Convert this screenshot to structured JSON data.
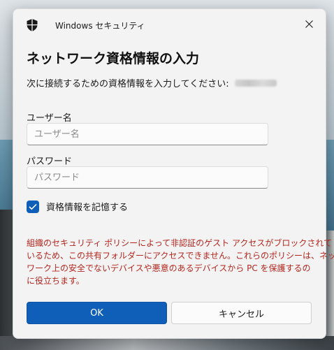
{
  "window": {
    "app_title": "Windows セキュリティ",
    "close_icon": "close-icon",
    "app_icon": "shield-icon"
  },
  "dialog": {
    "heading": "ネットワーク資格情報の入力",
    "prompt": "次に接続するための資格情報を入力してください:"
  },
  "username": {
    "label": "ユーザー名",
    "placeholder": "ユーザー名",
    "value": ""
  },
  "password": {
    "label": "パスワード",
    "placeholder": "パスワード",
    "value": ""
  },
  "remember": {
    "label": "資格情報を記憶する",
    "checked": true
  },
  "warning": {
    "lines": [
      "組織のセキュリティ ポリシーによって非認証のゲスト アクセスがブロックされて",
      "いるため、この共有フォルダーにアクセスできません。これらのポリシーは、ネット",
      "ワーク上の安全でないデバイスや悪意のあるデバイスから PC を保護するの",
      "に役立ちます。"
    ]
  },
  "buttons": {
    "ok": "OK",
    "cancel": "キャンセル"
  },
  "colors": {
    "accent": "#0f5fb8",
    "warning": "#b3261e"
  }
}
